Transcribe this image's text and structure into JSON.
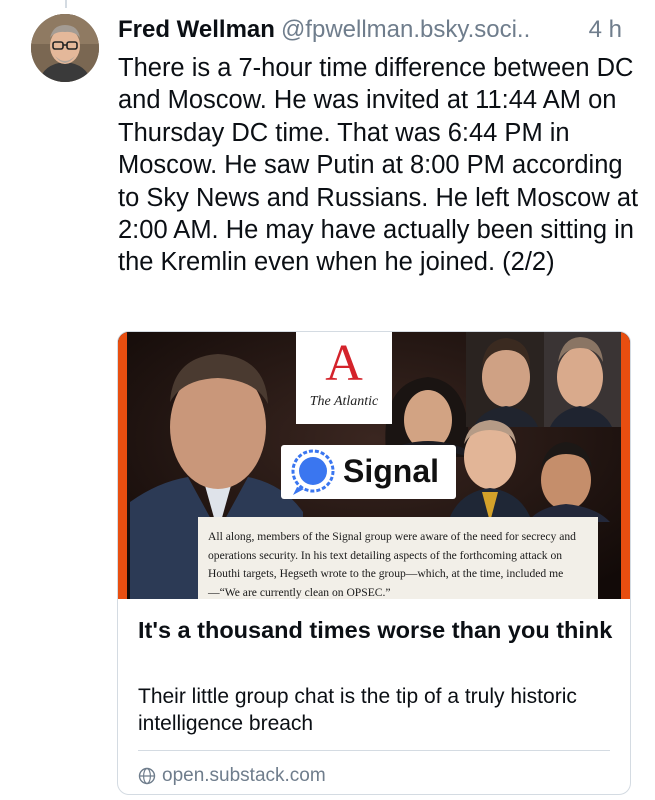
{
  "post": {
    "author": "Fred Wellman",
    "handle": "@fpwellman.bsky.soci..",
    "time": "4 h",
    "text": "There is a 7-hour time difference between DC and Moscow. He was invited at 11:44 AM on Thursday DC time. That was 6:44 PM in Moscow. He saw Putin at 8:00 PM according to Sky News and Russians. He left Moscow at 2:00 AM. He may have actually been sitting in the Kremlin even when he joined. (2/2)"
  },
  "card": {
    "image": {
      "logo_letter": "A",
      "logo_name": "The Atlantic",
      "signal_label": "Signal",
      "quote": "All along, members of the Signal group were aware of the need for secrecy and operations security. In his text detailing aspects of the forthcoming attack on Houthi targets, Hegseth wrote to the group—which, at the time, included me —“We are currently clean on OPSEC.”"
    },
    "title": "It's a thousand times worse than you think",
    "description": "Their little group chat is the tip of a truly historic intelligence breach",
    "domain": "open.substack.com",
    "domain_icon": "globe-icon"
  },
  "colors": {
    "text": "#0b0f14",
    "muted": "#6f7d8c",
    "border": "#d4dbe2",
    "orange_frame": "#e84e10"
  }
}
